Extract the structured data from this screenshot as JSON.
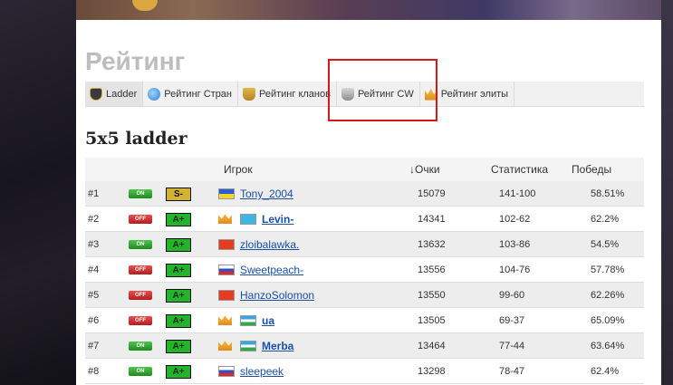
{
  "page": {
    "title": "Рейтинг"
  },
  "tabs": [
    {
      "label": "Ladder",
      "icon": "ladder-shield-icon"
    },
    {
      "label": "Рейтинг Стран",
      "icon": "globe-icon"
    },
    {
      "label": "Рейтинг кланов",
      "icon": "trophy-icon"
    },
    {
      "label": "Рейтинг CW",
      "icon": "trophy-silver-icon"
    },
    {
      "label": "Рейтинг элиты",
      "icon": "crown-icon"
    }
  ],
  "section": {
    "title": "5x5 ladder"
  },
  "table": {
    "headers": {
      "player": "Игрок",
      "score": "↓Очки",
      "stats": "Статистика",
      "wins": "Победы"
    },
    "rows": [
      {
        "rank": "#1",
        "status": "ON",
        "league": "S-",
        "crown": false,
        "flag": "ua",
        "player": "Tony_2004",
        "bold": false,
        "score": "15079",
        "stats": "141-100",
        "wins": "58.51%"
      },
      {
        "rank": "#2",
        "status": "OFF",
        "league": "A+",
        "crown": true,
        "flag": "kz",
        "player": "Levin-",
        "bold": true,
        "score": "14341",
        "stats": "102-62",
        "wins": "62.2%"
      },
      {
        "rank": "#3",
        "status": "ON",
        "league": "A+",
        "crown": false,
        "flag": "kg",
        "player": "zloibalawka.",
        "bold": false,
        "score": "13632",
        "stats": "103-86",
        "wins": "54.5%"
      },
      {
        "rank": "#4",
        "status": "OFF",
        "league": "A+",
        "crown": false,
        "flag": "ru",
        "player": "Sweetpeach-",
        "bold": false,
        "score": "13556",
        "stats": "104-76",
        "wins": "57.78%"
      },
      {
        "rank": "#5",
        "status": "OFF",
        "league": "A+",
        "crown": false,
        "flag": "kg",
        "player": "HanzoSolomon",
        "bold": false,
        "score": "13550",
        "stats": "99-60",
        "wins": "62.26%"
      },
      {
        "rank": "#6",
        "status": "OFF",
        "league": "A+",
        "crown": true,
        "flag": "uz",
        "player": "ua",
        "bold": true,
        "score": "13505",
        "stats": "69-37",
        "wins": "65.09%"
      },
      {
        "rank": "#7",
        "status": "ON",
        "league": "A+",
        "crown": true,
        "flag": "uz",
        "player": "Merba",
        "bold": true,
        "score": "13464",
        "stats": "77-44",
        "wins": "63.64%"
      },
      {
        "rank": "#8",
        "status": "ON",
        "league": "A+",
        "crown": false,
        "flag": "ru",
        "player": "sleepeek",
        "bold": false,
        "score": "13298",
        "stats": "78-47",
        "wins": "62.4%"
      }
    ]
  },
  "colors": {
    "highlight": "#d81818",
    "link": "#1c4fa8",
    "online": "#1f8a1f",
    "offline": "#b51c1c"
  }
}
